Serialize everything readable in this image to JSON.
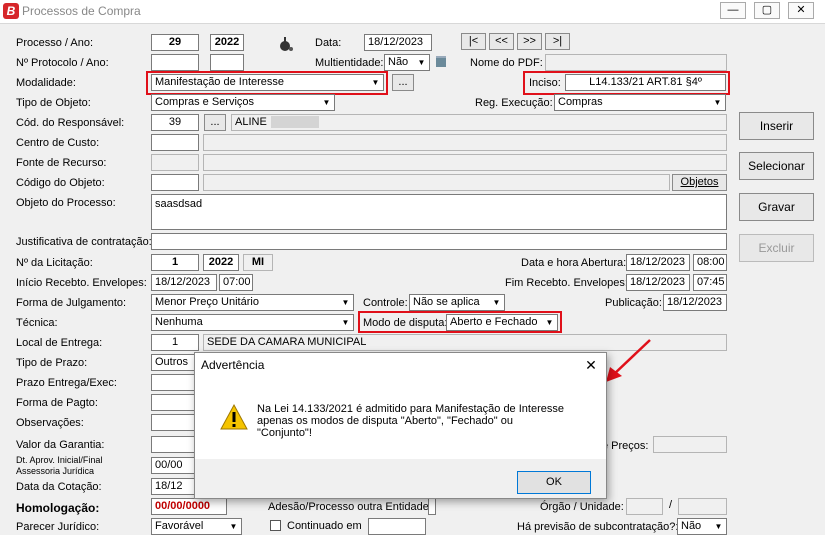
{
  "window": {
    "title": "Processos de Compra",
    "app_letter": "B",
    "minimize": "—",
    "maximize": "▢",
    "close": "✕"
  },
  "processo": {
    "label": "Processo / Ano:",
    "numero": "29",
    "ano": "2022",
    "data_label": "Data:",
    "data": "18/12/2023",
    "nav_first": "|<",
    "nav_prev": "<<",
    "nav_next": ">>",
    "nav_last": ">|"
  },
  "protocolo": {
    "label": "Nº Protocolo / Ano:",
    "multientidade_label": "Multientidade:",
    "multientidade_value": "Não",
    "nome_pdf_label": "Nome do PDF:"
  },
  "modalidade": {
    "label": "Modalidade:",
    "value": "Manifestação de Interesse",
    "more": "...",
    "inciso_label": "Inciso:",
    "inciso_value": "L14.133/21 ART.81 §4º"
  },
  "tipo_objeto": {
    "label": "Tipo de Objeto:",
    "value": "Compras e Serviços",
    "reg_label": "Reg. Execução:",
    "reg_value": "Compras"
  },
  "responsavel": {
    "label": "Cód. do Responsável:",
    "codigo": "39",
    "more": "...",
    "nome": "ALINE"
  },
  "labels": {
    "centro_custo": "Centro de Custo:",
    "fonte_recurso": "Fonte de Recurso:",
    "codigo_objeto": "Código do Objeto:",
    "objetos_btn": "Objetos",
    "objeto_processo": "Objeto do Processo:",
    "justificativa": "Justificativa de contratação:",
    "licitacao": "Nº da Licitação:",
    "data_abertura": "Data e hora Abertura:",
    "inicio_receb": "Início Recebto. Envelopes:",
    "fim_receb": "Fim Recebto. Envelopes:",
    "forma_julgamento": "Forma de Julgamento:",
    "controle": "Controle:",
    "publicacao": "Publicação:",
    "tecnica": "Técnica:",
    "modo_disputa": "Modo de disputa:",
    "local_entrega": "Local de Entrega:",
    "tipo_prazo": "Tipo de Prazo:",
    "prazo_entrega": "Prazo Entrega/Exec:",
    "forma_pagto": "Forma de Pagto:",
    "observacoes": "Observações:",
    "valor_garantia": "Valor da Garantia:",
    "dt_aprov": "Dt. Aprov. Inicial/Final",
    "assessoria": "Assessoria Jurídica",
    "data_cotacao": "Data da Cotação:",
    "homologacao": "Homologação:",
    "adesao": "Adesão/Processo outra Entidade",
    "orgao_unidade": "Órgão / Unidade:",
    "parecer": "Parecer Jurídico:",
    "continuado": "Continuado em",
    "previsao": "Há previsão de subcontratação?:",
    "precos": "e Preços:"
  },
  "values": {
    "objeto_processo": "saasdsad",
    "licitacao_num": "1",
    "licitacao_ano": "2022",
    "licitacao_tipo": "MI",
    "abertura_data": "18/12/2023",
    "abertura_hora": "08:00",
    "inicio_data": "18/12/2023",
    "inicio_hora": "07:00",
    "fim_data": "18/12/2023",
    "fim_hora": "07:45",
    "forma_julgamento": "Menor Preço Unitário",
    "controle": "Não se aplica",
    "publicacao": "18/12/2023",
    "tecnica": "Nenhuma",
    "modo_disputa": "Aberto e Fechado",
    "local_codigo": "1",
    "local_nome": "SEDE DA CAMARA MUNICIPAL",
    "tipo_prazo": "Outros",
    "dt_aprov_partial": "00/00",
    "data_cotacao_partial": "18/12",
    "homologacao_partial": "00/00/0000",
    "orgao_sep": "/",
    "parecer": "Favorável",
    "previsao": "Não"
  },
  "side_buttons": {
    "inserir": "Inserir",
    "selecionar": "Selecionar",
    "gravar": "Gravar",
    "excluir": "Excluir"
  },
  "dialog": {
    "title": "Advertência",
    "close": "✕",
    "message_line1": "Na Lei 14.133/2021 é admitido para Manifestação de Interesse",
    "message_line2": "apenas os modos de disputa \"Aberto\", \"Fechado\" ou",
    "message_line3": "\"Conjunto\"!",
    "ok": "OK"
  },
  "colors": {
    "highlight_red": "#e0101a",
    "dialog_accent": "#0078d7"
  }
}
